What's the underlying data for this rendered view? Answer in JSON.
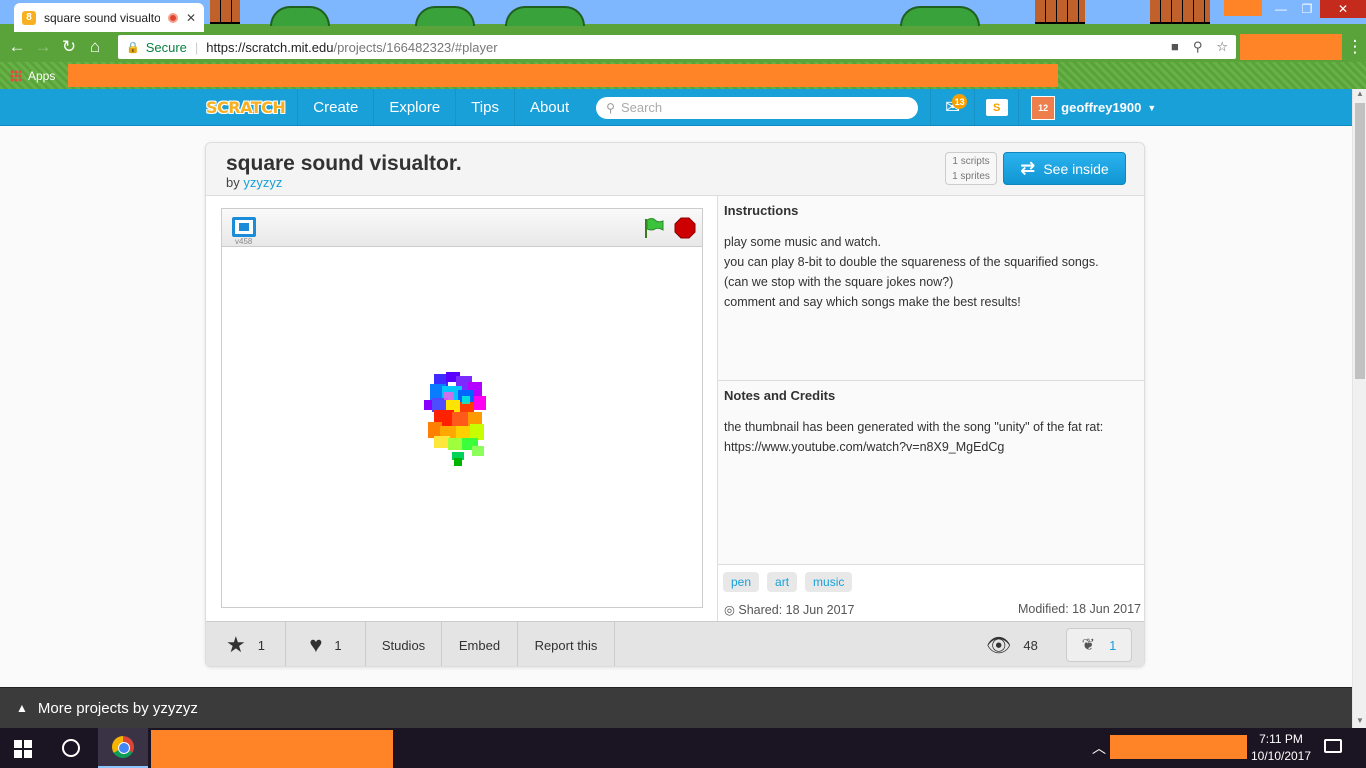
{
  "browser": {
    "tab_title": "square sound visualto",
    "url_secure": "Secure",
    "url_host": "https://scratch.mit.edu",
    "url_path": "/projects/166482323/#player",
    "bookmarks_apps": "Apps"
  },
  "nav": {
    "logo": "SCRATCH",
    "links": [
      "Create",
      "Explore",
      "Tips",
      "About"
    ],
    "search_placeholder": "Search",
    "messages_count": "13",
    "username": "geoffrey1900"
  },
  "project": {
    "title": "square sound visualtor.",
    "by_label": "by",
    "author": "yzyzyz",
    "scripts": "1 scripts",
    "sprites": "1 sprites",
    "see_inside": "See inside",
    "version": "v458",
    "instructions_heading": "Instructions",
    "instructions_lines": [
      "play some music and watch.",
      "you can play 8-bit to double the squareness of the squarified songs.",
      "(can we stop with the square jokes now?)",
      "comment and say which songs make the best results!"
    ],
    "notes_heading": "Notes and Credits",
    "notes_lines": [
      "the thumbnail has been generated with the song \"unity\" of the fat rat:",
      "https://www.youtube.com/watch?v=n8X9_MgEdCg"
    ],
    "tags": [
      "pen",
      "art",
      "music"
    ],
    "shared": "Shared: 18 Jun 2017",
    "modified": "Modified: 18 Jun 2017",
    "favorites": "1",
    "loves": "1",
    "studios": "Studios",
    "embed": "Embed",
    "report": "Report this",
    "views": "48",
    "remixes": "1"
  },
  "more_projects": "More projects by yzyzyz",
  "taskbar": {
    "time": "7:11 PM",
    "date": "10/10/2017"
  },
  "colors": {
    "scratch_blue": "#1aa0d8",
    "redaction_orange": "#ff8427",
    "chrome_green": "#5aa23a"
  }
}
